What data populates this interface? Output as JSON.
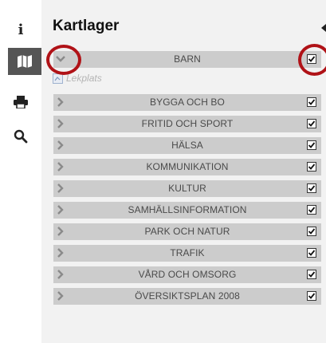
{
  "panel": {
    "title": "Kartlager"
  },
  "toolbar": {
    "tools": [
      {
        "icon": "info-icon",
        "glyph": "i"
      },
      {
        "icon": "map-icon",
        "active": true
      },
      {
        "icon": "print-icon"
      },
      {
        "icon": "search-icon"
      }
    ]
  },
  "layers": {
    "expanded": {
      "label": "BARN",
      "checked": true,
      "sublayers": [
        {
          "label": "Lekplats"
        }
      ]
    },
    "items": [
      {
        "label": "BYGGA OCH BO",
        "checked": true
      },
      {
        "label": "FRITID OCH SPORT",
        "checked": true
      },
      {
        "label": "HÄLSA",
        "checked": true
      },
      {
        "label": "KOMMUNIKATION",
        "checked": true
      },
      {
        "label": "KULTUR",
        "checked": true
      },
      {
        "label": "SAMHÄLLSINFORMATION",
        "checked": true
      },
      {
        "label": "PARK OCH NATUR",
        "checked": true
      },
      {
        "label": "TRAFIK",
        "checked": true
      },
      {
        "label": "VÅRD OCH OMSORG",
        "checked": true
      },
      {
        "label": "ÖVERSIKTSPLAN 2008",
        "checked": true
      }
    ]
  },
  "colors": {
    "highlight_ring": "#b01217",
    "row_background": "#cccccc",
    "active_tool": "#555555"
  }
}
